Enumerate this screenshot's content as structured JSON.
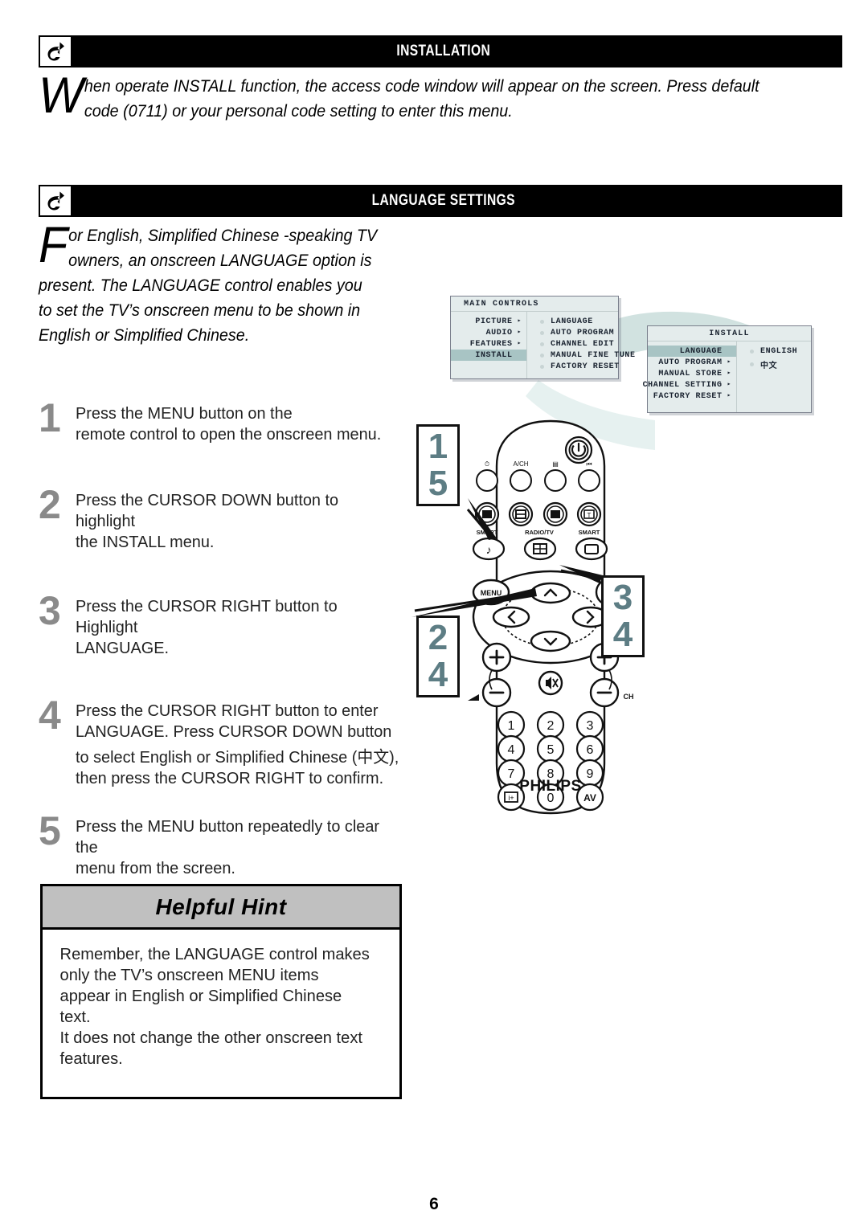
{
  "document": {
    "page_number": "6",
    "brand": "PHILIPS"
  },
  "sections": [
    {
      "id": "installation",
      "title": "Installation",
      "logo_icon": "philips-shield-icon",
      "intro_dropcap": "W",
      "intro_rest": "hen operate INSTALL function, the access code window will appear on the screen. Press default code (0711) or your personal code setting to enter this menu."
    },
    {
      "id": "language-settings",
      "title": "Language Settings",
      "logo_icon": "philips-shield-icon",
      "intro_dropcap": "F",
      "intro_rest": "or English, Simplified Chinese -speaking TV owners, an onscreen LANGUAGE option is present. The LANGUAGE control enables you to set the TV’s onscreen menu to be shown in English or Simplified Chinese."
    }
  ],
  "steps": [
    {
      "num": "1",
      "lines": [
        "Press the MENU button on the",
        "remote control to open the onscreen menu."
      ]
    },
    {
      "num": "2",
      "lines": [
        "Press the CURSOR DOWN button to highlight",
        "the INSTALL menu."
      ]
    },
    {
      "num": "3",
      "lines": [
        "Press the CURSOR RIGHT button to Highlight",
        "LANGUAGE."
      ]
    },
    {
      "num": "4",
      "lines": [
        "Press the CURSOR RIGHT button to enter",
        "LANGUAGE. Press CURSOR DOWN button",
        "to select English or Simplified Chinese (中文),",
        "then press the CURSOR RIGHT to confirm."
      ]
    },
    {
      "num": "5",
      "lines": [
        "Press the MENU  button repeatedly to clear the",
        "menu from the screen."
      ]
    }
  ],
  "osd": {
    "main": {
      "title": "MAIN CONTROLS",
      "left_items": [
        {
          "label": "PICTURE",
          "arrow": "▸",
          "selected": false
        },
        {
          "label": "AUDIO",
          "arrow": "▸",
          "selected": false
        },
        {
          "label": "FEATURES",
          "arrow": "▸",
          "selected": false
        },
        {
          "label": "INSTALL",
          "arrow": "",
          "selected": true
        }
      ],
      "right_items": [
        {
          "label": "LANGUAGE"
        },
        {
          "label": "AUTO PROGRAM"
        },
        {
          "label": "CHANNEL EDIT"
        },
        {
          "label": "MANUAL FINE TUNE"
        },
        {
          "label": "FACTORY RESET"
        }
      ]
    },
    "install": {
      "title": "INSTALL",
      "left_items": [
        {
          "label": "LANGUAGE",
          "arrow": "",
          "selected": true
        },
        {
          "label": "AUTO PROGRAM",
          "arrow": "▸",
          "selected": false
        },
        {
          "label": "MANUAL STORE",
          "arrow": "▸",
          "selected": false
        },
        {
          "label": "CHANNEL SETTING",
          "arrow": "▸",
          "selected": false
        },
        {
          "label": "FACTORY RESET",
          "arrow": "▸",
          "selected": false
        }
      ],
      "right_items": [
        {
          "label": "ENGLISH"
        },
        {
          "label": "中文"
        }
      ]
    }
  },
  "callouts": [
    {
      "id": "callout-top-left",
      "lines": [
        "1",
        "5"
      ]
    },
    {
      "id": "callout-bottom-left",
      "lines": [
        "2",
        "4"
      ]
    },
    {
      "id": "callout-right",
      "lines": [
        "3",
        "4"
      ]
    }
  ],
  "remote": {
    "brand": "PHILIPS",
    "power_icon": "power-icon",
    "row1": [
      {
        "icon_label": "⏱",
        "name": "sleep-timer-icon"
      },
      {
        "icon_label": "A/CH",
        "name": "alt-channel-icon"
      },
      {
        "icon_label": "▤",
        "name": "pip-icon"
      },
      {
        "icon_label": "⏯",
        "name": "freeze-icon"
      }
    ],
    "row2": [
      {
        "name": "menu-list-icon"
      },
      {
        "name": "format-icon"
      },
      {
        "name": "text-icon"
      },
      {
        "name": "subtitle-icon"
      }
    ],
    "row3_labels": [
      "SMART",
      "RADIO/TV",
      "SMART"
    ],
    "row3": [
      {
        "icon_label": "♪",
        "name": "smart-sound-icon"
      },
      {
        "icon_label": "▦",
        "name": "radio-tv-icon"
      },
      {
        "icon_label": "▭",
        "name": "smart-picture-icon"
      }
    ],
    "menu_label": "MENU",
    "cursor": {
      "up": "˄",
      "down": "˅",
      "left": "‹",
      "right": "›"
    },
    "exit_icon": "exit-icon",
    "volume_label": "◁",
    "channel_label": "CH",
    "mute_icon": "mute-icon",
    "plus": "+",
    "minus": "−",
    "keypad": [
      [
        "1",
        "2",
        "3"
      ],
      [
        "4",
        "5",
        "6"
      ],
      [
        "7",
        "8",
        "9"
      ],
      [
        "ⓘ",
        "0",
        "AV"
      ]
    ]
  },
  "hint": {
    "header_text": "Helpful Hint",
    "lines": [
      "Remember, the LANGUAGE control makes",
      "only the TV’s onscreen MENU items",
      "appear in English or Simplified Chinese text.",
      "It does not change the other onscreen text",
      "features."
    ]
  },
  "colors": {
    "header_bar": "#000000",
    "header_text": "#ffffff",
    "osd_bg": "#e4ecec",
    "osd_selected": "#a8c4c4",
    "callout_number": "#5d7d84",
    "step_number": "#8a8a8a",
    "hint_header_bg": "#c0c0c0",
    "swoosh": "#cfe0de"
  }
}
